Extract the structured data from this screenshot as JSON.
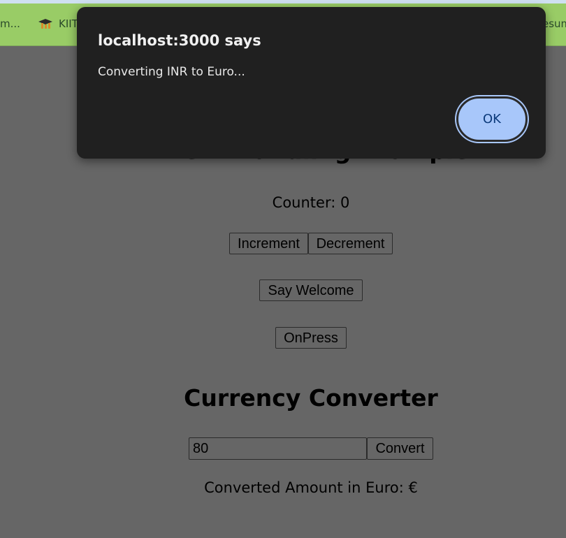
{
  "bookmarks": {
    "left_item": "m...",
    "kiit_item": "KIIT",
    "right_item": "esum"
  },
  "page": {
    "event_heading": "Event Handling Example",
    "counter_text": "Counter: 0",
    "increment_label": "Increment",
    "decrement_label": "Decrement",
    "say_welcome_label": "Say Welcome",
    "onpress_label": "OnPress",
    "currency_heading": "Currency Converter",
    "amount_value": "80",
    "convert_label": "Convert",
    "converted_text": "Converted Amount in Euro: €"
  },
  "dialog": {
    "title": "localhost:3000 says",
    "message": "Converting INR to Euro...",
    "ok_label": "OK"
  },
  "icons": {
    "kiit": "graduation-cap-icon"
  },
  "colors": {
    "bookmarks_bar": "#99cc66",
    "overlay_bg": "#666666",
    "dialog_bg": "#202020",
    "ok_button": "#a8c7fa"
  }
}
